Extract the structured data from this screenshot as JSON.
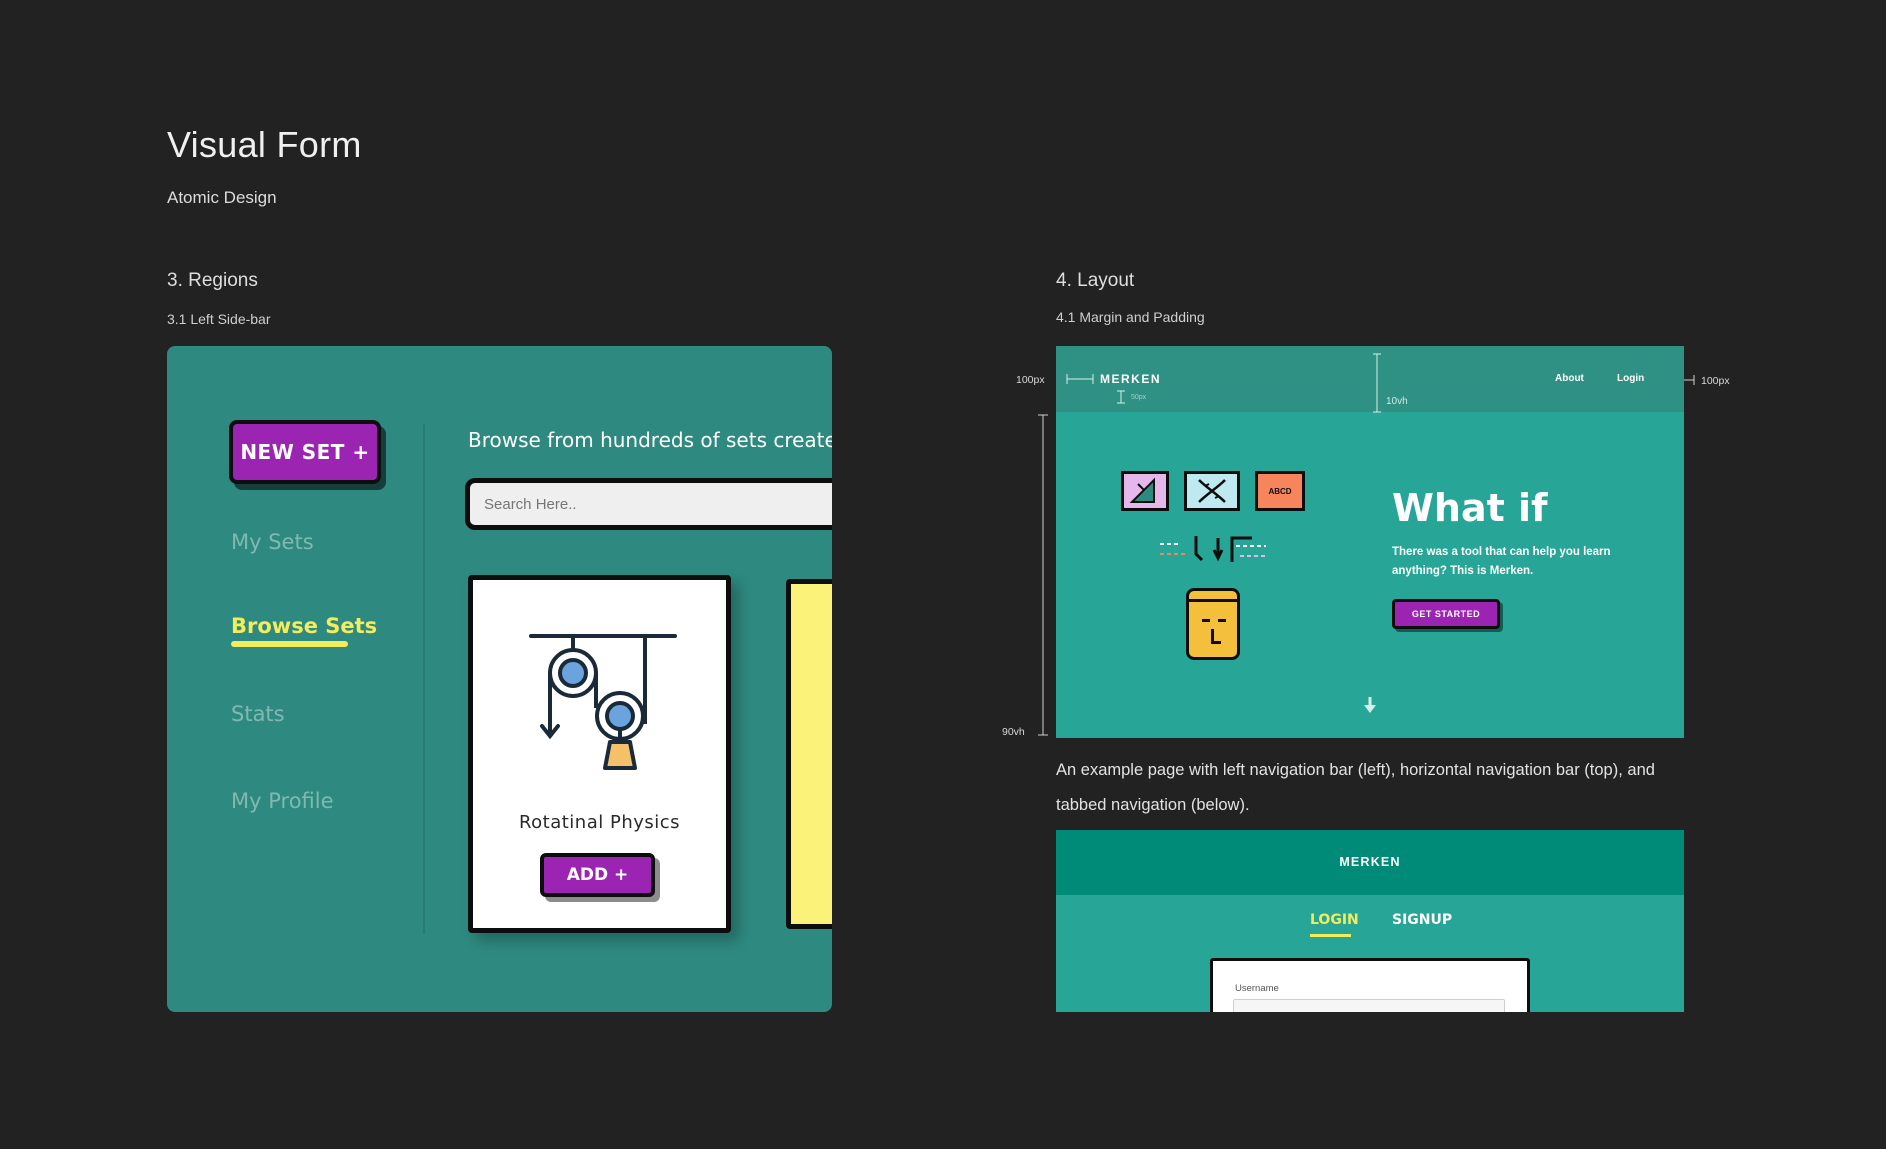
{
  "page": {
    "title": "Visual Form",
    "subtitle": "Atomic Design"
  },
  "regions": {
    "title": "3. Regions",
    "subtitle": "3.1 Left Side-bar",
    "new_set_label": "NEW SET +",
    "side_items": [
      {
        "label": "My Sets",
        "active": false
      },
      {
        "label": "Browse Sets",
        "active": true
      },
      {
        "label": "Stats",
        "active": false
      },
      {
        "label": "My Profile",
        "active": false
      }
    ],
    "browse_heading": "Browse from hundreds of sets created by",
    "search_placeholder": "Search Here..",
    "card": {
      "title": "Rotatinal Physics",
      "add_label": "ADD +"
    },
    "colors": {
      "panel_bg": "#2e8a80",
      "accent_purple": "#9b24b3",
      "active_yellow": "#f3ec5b",
      "card2_yellow": "#fbf27a"
    }
  },
  "layout": {
    "title": "4. Layout",
    "subtitle": "4.1 Margin and Padding",
    "annotations": {
      "left_margin": "100px",
      "right_margin": "100px",
      "nav_height": "10vh",
      "logo_padding": "50px",
      "hero_height": "90vh"
    },
    "nav": {
      "logo": "MERKEN",
      "links": [
        "About",
        "Login"
      ]
    },
    "hero": {
      "title": "What if",
      "text": "There was a tool that can help you learn anything? This is Merken.",
      "button": "GET STARTED",
      "icon_tile_text": "ABCD"
    },
    "caption": "An example page with left navigation bar (left), horizontal navigation bar (top), and tabbed navigation (below).",
    "login": {
      "brand": "MERKEN",
      "tabs": [
        {
          "label": "LOGIN",
          "active": true
        },
        {
          "label": "SIGNUP",
          "active": false
        }
      ],
      "username_label": "Username"
    }
  }
}
